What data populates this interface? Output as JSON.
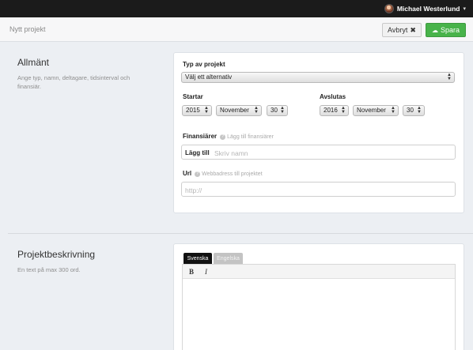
{
  "topbar": {
    "username": "Michael Westerlund",
    "caret": "▾"
  },
  "actionbar": {
    "title": "Nytt projekt",
    "cancel_label": "Avbryt",
    "cancel_icon": "✖",
    "save_label": "Spara",
    "save_icon": "☁"
  },
  "general": {
    "title": "Allmänt",
    "description": "Ange typ, namn, deltagare, tidsinterval och finansiär.",
    "project_type": {
      "label": "Typ av projekt",
      "value": "Välj ett alternativ"
    },
    "start": {
      "label": "Startar",
      "year": "2015",
      "month": "November",
      "day": "30"
    },
    "end": {
      "label": "Avslutas",
      "year": "2016",
      "month": "November",
      "day": "30"
    },
    "financiers": {
      "label": "Finansiärer",
      "hint": "Lägg till finansiärer",
      "addon": "Lägg till",
      "placeholder": "Skriv namn"
    },
    "url": {
      "label": "Url",
      "hint": "Webbadress till projektet",
      "placeholder": "http://"
    }
  },
  "description": {
    "title": "Projektbeskrivning",
    "subtitle": "En text på max 300 ord.",
    "tabs": [
      "Svenska",
      "Engelska"
    ],
    "toolbar": {
      "bold": "B",
      "italic": "I"
    }
  },
  "icons": {
    "help": "?",
    "select_arrows": "▲▼"
  },
  "colors": {
    "save_green": "#48b34a",
    "topbar": "#1b1b1b",
    "active_tab": "#111111"
  }
}
